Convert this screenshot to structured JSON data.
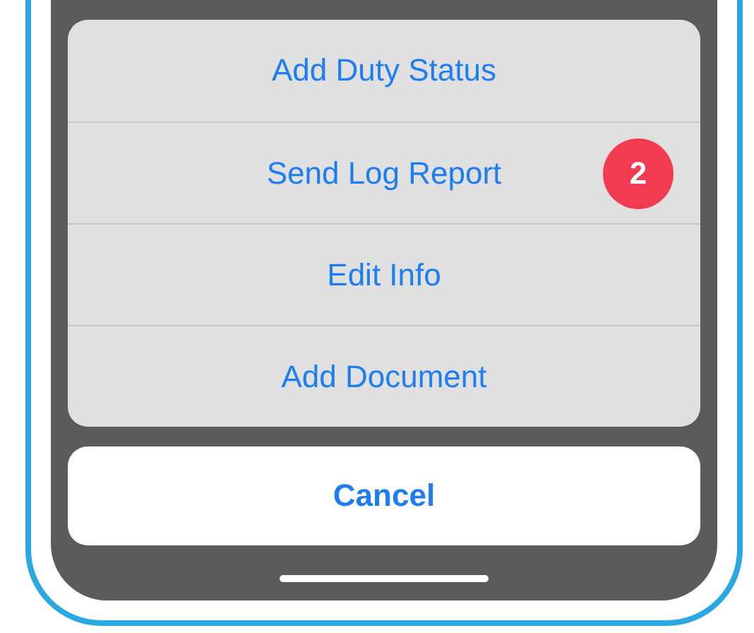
{
  "action_sheet": {
    "actions": [
      {
        "label": "Add Duty Status"
      },
      {
        "label": "Send Log Report",
        "badge": "2"
      },
      {
        "label": "Edit Info"
      },
      {
        "label": "Add Document"
      }
    ],
    "cancel": "Cancel"
  }
}
